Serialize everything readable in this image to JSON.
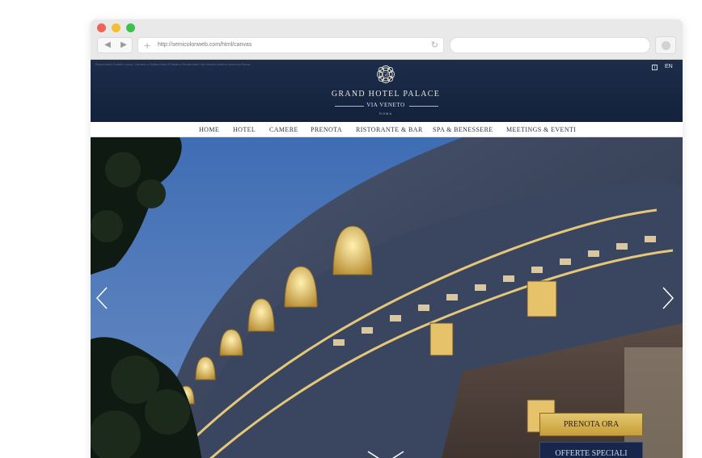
{
  "browser": {
    "url": "http://semicolonweb.com/html/canvas",
    "back_icon": "◀",
    "forward_icon": "▶",
    "plus_icon": "+",
    "reload_icon": "↻"
  },
  "site": {
    "header_tagline": "Roma hotel 5 stelle Lusso, Camere e Suites Hotel 5 Stelle a Roma Hotel Via Veneto Hotel in centro a Roma",
    "lang_separator": "|",
    "lang": "EN",
    "logo_monogram": "GP",
    "logo_title": "GRAND HOTEL PALACE",
    "logo_subtitle": "VIA VENETO",
    "logo_city": "ROMA",
    "menu": [
      {
        "label": "HOME"
      },
      {
        "label": "HOTEL"
      },
      {
        "label": "CAMERE"
      },
      {
        "label": "PRENOTA"
      },
      {
        "label": "RISTORANTE & BAR"
      },
      {
        "label": "SPA & BENESSERE"
      },
      {
        "label": "MEETINGS & EVENTI"
      }
    ],
    "cta_book": "PRENOTA ORA",
    "cta_offers": "OFFERTE SPECIALI"
  },
  "colors": {
    "header_navy": "#16233d",
    "gold": "#d4b256",
    "menu_text": "#1e2b44"
  }
}
